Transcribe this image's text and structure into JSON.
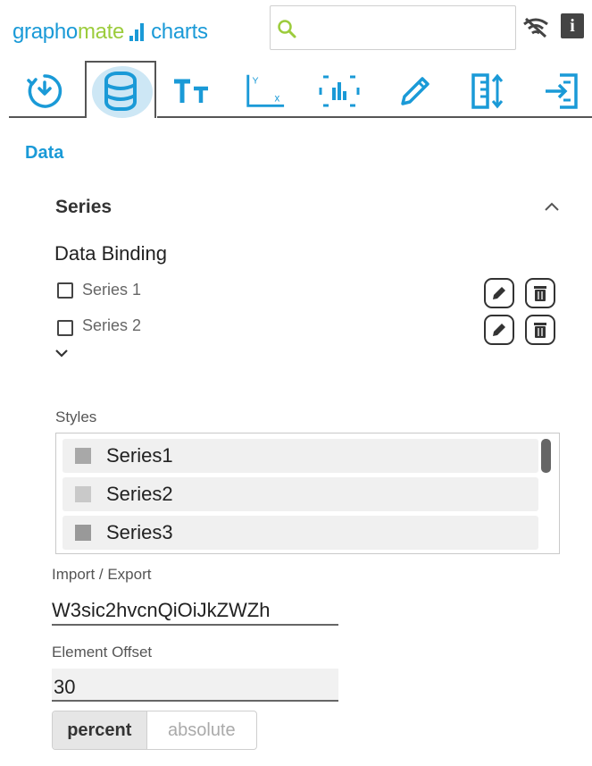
{
  "header": {
    "logo_part1": "grapho",
    "logo_part2": "mate",
    "logo_part3": "charts",
    "search": {
      "value": "",
      "placeholder": ""
    }
  },
  "toolbar": {
    "icons": [
      "reset-icon",
      "data-icon",
      "text-icon",
      "axis-icon",
      "chart-layout-icon",
      "pen-icon",
      "sort-icon",
      "export-icon"
    ],
    "active": "data-icon"
  },
  "section": {
    "title": "Data"
  },
  "series_panel": {
    "title": "Series",
    "data_binding_title": "Data Binding",
    "series": [
      {
        "label": "Series 1",
        "checked": false
      },
      {
        "label": "Series 2",
        "checked": false
      }
    ]
  },
  "styles": {
    "label": "Styles",
    "items": [
      {
        "label": "Series1",
        "color": "#a8a8a8"
      },
      {
        "label": "Series2",
        "color": "#c9c9c9"
      },
      {
        "label": "Series3",
        "color": "#999999"
      }
    ]
  },
  "import_export": {
    "label": "Import / Export",
    "value": "W3sic2hvcnQiOiJkZWZh"
  },
  "element_offset": {
    "label": "Element Offset",
    "value": "30",
    "options": [
      "percent",
      "absolute"
    ],
    "selected": "percent"
  },
  "colors": {
    "accent": "#1a9ad7",
    "logo_green": "#9ccc3c",
    "active_tab_bg": "#cde7f5"
  }
}
